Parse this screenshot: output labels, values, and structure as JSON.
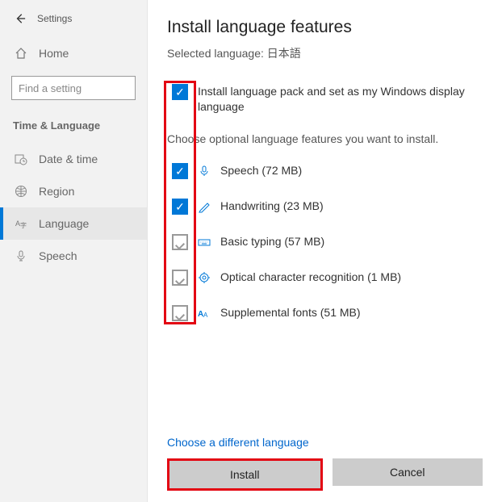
{
  "sidebar": {
    "title": "Settings",
    "home": "Home",
    "search_placeholder": "Find a setting",
    "section": "Time & Language",
    "items": [
      {
        "label": "Date & time"
      },
      {
        "label": "Region"
      },
      {
        "label": "Language"
      },
      {
        "label": "Speech"
      }
    ]
  },
  "main": {
    "title": "Install language features",
    "subtitle": "Selected language: 日本語",
    "primary_feature": "Install language pack and set as my Windows display language",
    "desc": "Choose optional language features you want to install.",
    "features": [
      {
        "label": "Speech (72 MB)"
      },
      {
        "label": "Handwriting (23 MB)"
      },
      {
        "label": "Basic typing (57 MB)"
      },
      {
        "label": "Optical character recognition (1 MB)"
      },
      {
        "label": "Supplemental fonts (51 MB)"
      }
    ],
    "link": "Choose a different language",
    "install": "Install",
    "cancel": "Cancel"
  }
}
